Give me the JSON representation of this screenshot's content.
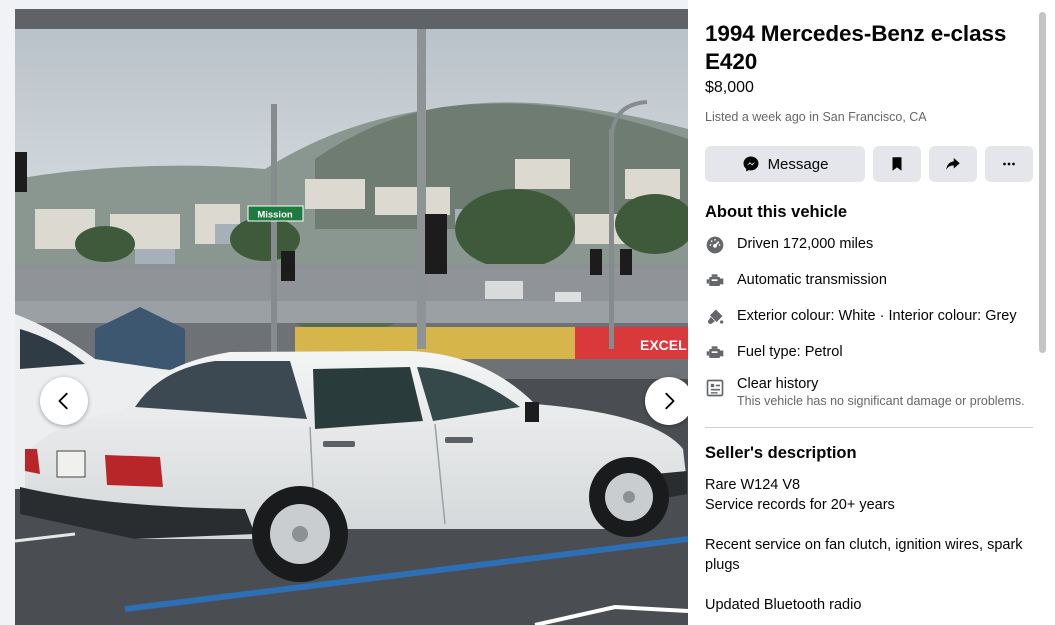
{
  "listing": {
    "title": "1994 Mercedes-Benz e-class E420",
    "price": "$8,000",
    "listed": "Listed a week ago in San Francisco, CA"
  },
  "actions": {
    "message_label": "Message",
    "save_icon": "bookmark-icon",
    "share_icon": "share-icon",
    "more_icon": "more-icon"
  },
  "photo": {
    "street_sign": "Mission",
    "banner_text": "EXCEL",
    "prev_icon": "chevron-left-icon",
    "next_icon": "chevron-right-icon"
  },
  "about": {
    "heading": "About this vehicle",
    "items": [
      {
        "icon": "speedometer-icon",
        "text": "Driven 172,000 miles"
      },
      {
        "icon": "engine-icon",
        "text": "Automatic transmission"
      },
      {
        "icon": "paint-icon",
        "text": "Exterior colour: White · Interior colour: Grey"
      },
      {
        "icon": "engine-icon",
        "text": "Fuel type: Petrol"
      },
      {
        "icon": "document-icon",
        "text": "Clear history",
        "sub": "This vehicle has no significant damage or problems."
      }
    ]
  },
  "seller": {
    "heading": "Seller's description",
    "lines": [
      "Rare W124 V8",
      "Service records for 20+ years",
      "Recent service on fan clutch, ignition wires, spark plugs",
      "Updated Bluetooth radio"
    ]
  },
  "colors": {
    "panel_bg": "#ffffff",
    "button_bg": "#e4e6eb",
    "secondary_text": "#65676b",
    "page_bg": "#f0f2f5"
  }
}
